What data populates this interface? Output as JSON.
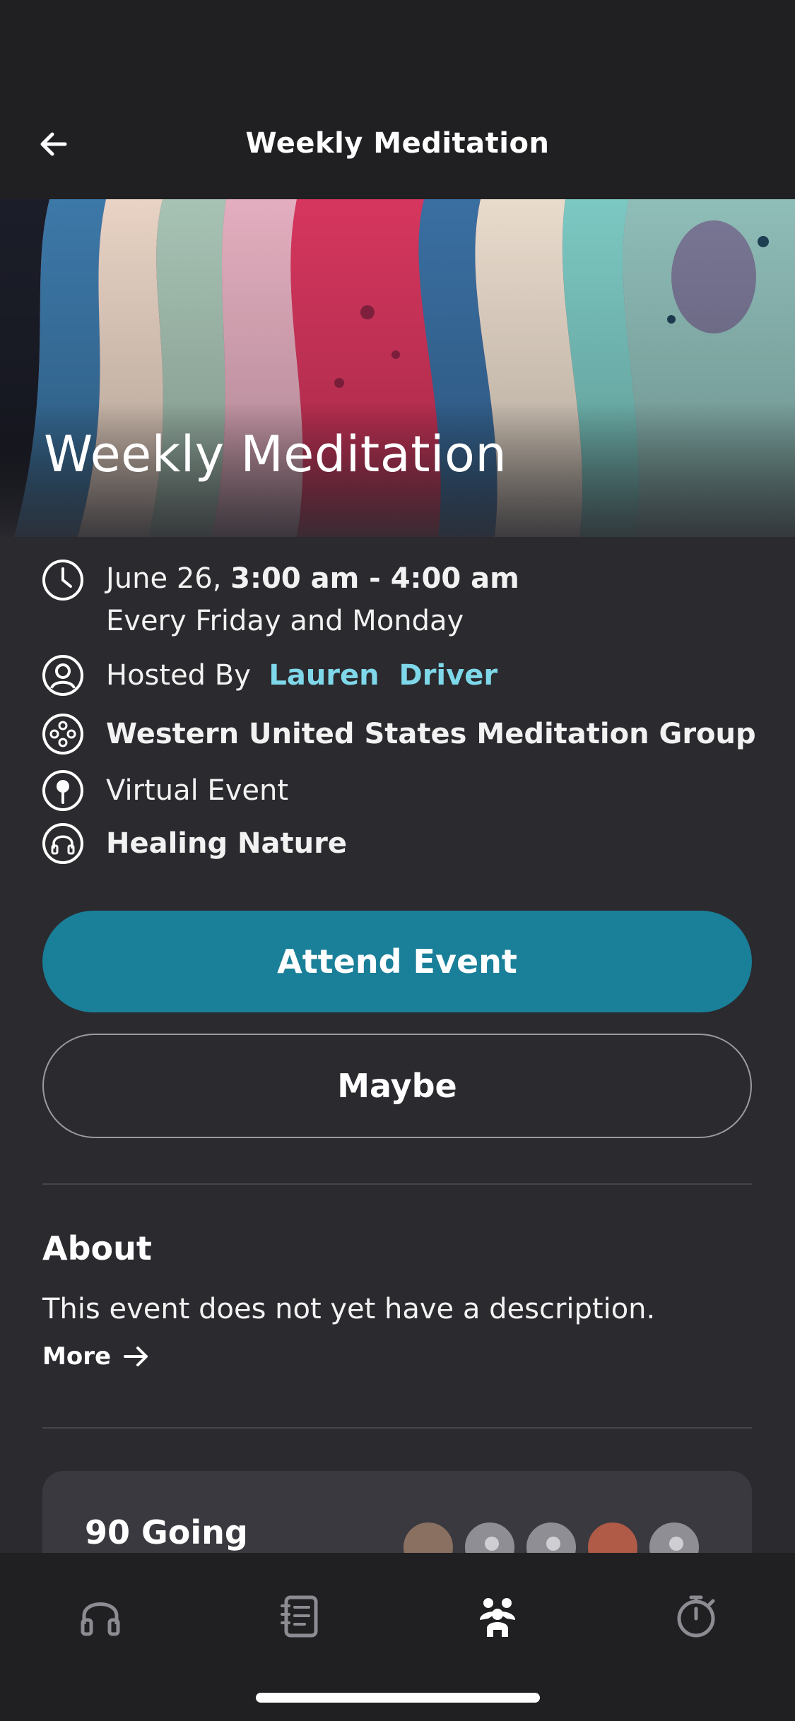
{
  "header": {
    "title": "Weekly Meditation"
  },
  "hero": {
    "title": "Weekly Meditation"
  },
  "event": {
    "date": "June 26,",
    "time": "3:00 am - 4:00 am",
    "recurrence": "Every Friday and Monday",
    "hosted_by_label": "Hosted By",
    "host_first": "Lauren",
    "host_last": "Driver",
    "group": "Western United States Meditation Group",
    "location": "Virtual Event",
    "track": "Healing Nature"
  },
  "actions": {
    "attend_label": "Attend Event",
    "maybe_label": "Maybe"
  },
  "about": {
    "heading": "About",
    "description": "This event does not yet have a description.",
    "more_label": "More"
  },
  "attendees": {
    "title": "90 Going"
  },
  "tabs": [
    {
      "icon": "headphones-icon"
    },
    {
      "icon": "journal-icon"
    },
    {
      "icon": "community-icon",
      "active": true
    },
    {
      "icon": "timer-icon"
    }
  ],
  "colors": {
    "accent": "#1a7f98",
    "link": "#7fd8ea",
    "background": "#2a2a2f",
    "bar": "#202023"
  }
}
